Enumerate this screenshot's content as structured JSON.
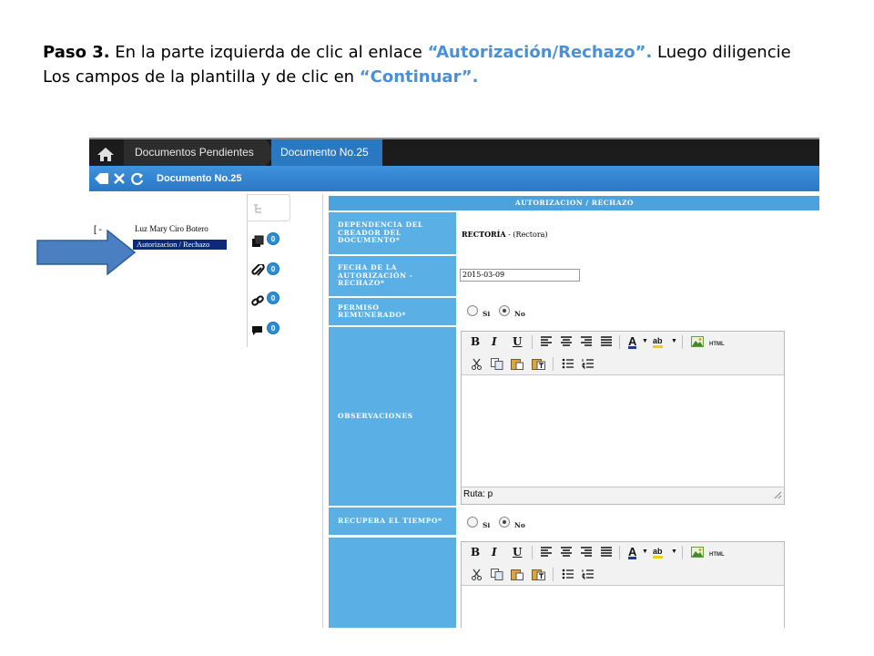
{
  "instruction": {
    "step": "Paso 3.",
    "part1": " En la parte izquierda de clic al enlace ",
    "link_quoted": "“Autorización/Rechazo”.",
    "part2": " Luego diligencie",
    "line2": "Los campos de la plantilla y de clic en ",
    "continue_quoted": "“Continuar”."
  },
  "breadcrumb": {
    "items": [
      "Documentos Pendientes",
      "Documento No.25"
    ]
  },
  "titlebar": {
    "title": "Documento No.25"
  },
  "tree": {
    "bracket": "[ -",
    "user": "Luz Mary Ciro Botero",
    "link": "Autorizacion / Rechazo"
  },
  "side_tabs": [
    {
      "icon": "documents-icon",
      "count": "0"
    },
    {
      "icon": "attachment-icon",
      "count": "0"
    },
    {
      "icon": "link-icon",
      "count": "0"
    },
    {
      "icon": "comment-icon",
      "count": "0"
    }
  ],
  "form": {
    "title": "AUTORIZACION / RECHAZO",
    "fields": {
      "dependencia": {
        "label": "DEPENDENCIA DEL CREADOR DEL DOCUMENTO*",
        "value_bold": "RECTORÍA",
        "value_rest": " - (Rectora)"
      },
      "fecha": {
        "label": "FECHA DE LA AUTORIZACIÓN - RECHAZO*",
        "value": "2015-03-09"
      },
      "permiso": {
        "label": "PERMISO REMUNERADO*",
        "option_si": "Si",
        "option_no": "No",
        "selected": "No"
      },
      "observaciones": {
        "label": "OBSERVACIONES",
        "path": "Ruta: p"
      },
      "recupera": {
        "label": "RECUPERA EL TIEMPO*",
        "option_si": "Si",
        "option_no": "No",
        "selected": "No"
      }
    }
  },
  "editor_toolbar": {
    "bold": "B",
    "italic": "I",
    "underline": "U",
    "font_color": "A",
    "highlight": "ab",
    "html": "HTML"
  },
  "colors": {
    "topbar": "#1c1c1c",
    "breadcrumb_active": "#2a78c0",
    "titlebar": "#3589d4",
    "form_label": "#5ab0e4",
    "instruction_accent": "#4a90d9",
    "callout_arrow": "#4a7fc1"
  }
}
